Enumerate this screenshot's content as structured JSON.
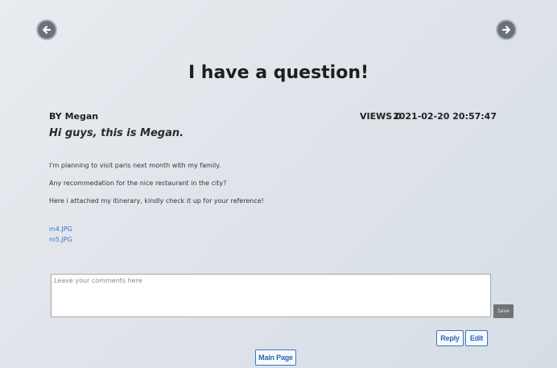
{
  "post": {
    "title": "I have a question!",
    "author": "BY Megan",
    "views": "VIEWS 0",
    "timestamp": "2021-02-20 20:57:47",
    "subtitle": "Hi guys, this is Megan.",
    "body_lines": [
      "I'm planning to visit paris next month with my family.",
      "Any recommedation for the nice restaurant in the city?",
      "Here i attached my itinerary, kindly check it up for your reference!"
    ],
    "attachments": [
      "m4.JPG",
      "m5.JPG"
    ]
  },
  "comment": {
    "placeholder": "Leave your comments here",
    "value": "",
    "save_label": "Save"
  },
  "actions": {
    "reply_label": "Reply",
    "edit_label": "Edit",
    "main_page_label": "Main Page"
  },
  "icons": {
    "prev": "arrow-left-circle-icon",
    "next": "arrow-right-circle-icon"
  },
  "colors": {
    "link": "#3a78c8",
    "nav_button": "#6b7178",
    "save_button": "#707478"
  }
}
